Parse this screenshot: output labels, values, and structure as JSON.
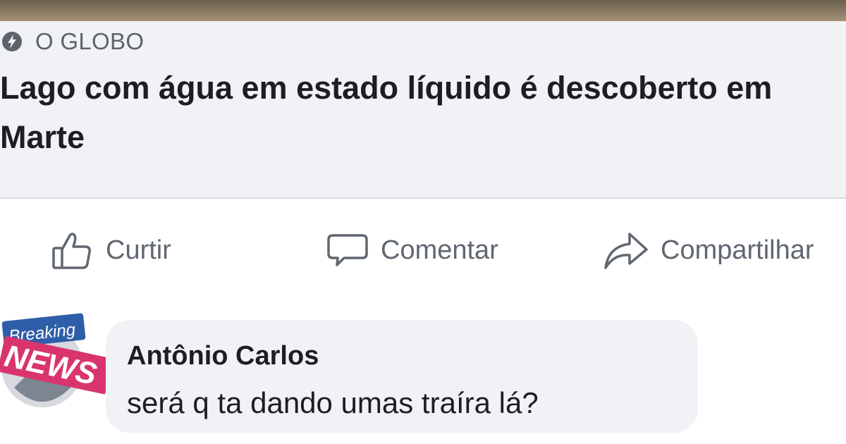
{
  "post": {
    "source": "O GLOBO",
    "source_icon": "bolt-circle-icon",
    "headline": "Lago com água em estado líquido é descoberto em Marte"
  },
  "actions": {
    "like": {
      "label": "Curtir",
      "icon": "thumbs-up-icon"
    },
    "comment": {
      "label": "Comentar",
      "icon": "speech-bubble-icon"
    },
    "share": {
      "label": "Compartilhar",
      "icon": "share-arrow-icon"
    }
  },
  "comment": {
    "avatar": {
      "line1": "Breaking",
      "line2": "NEWS"
    },
    "author": "Antônio Carlos",
    "text": "será q ta dando umas traíra lá?"
  },
  "colors": {
    "card_bg": "#f1f2f5",
    "text_primary": "#1c1e21",
    "text_secondary": "#606770",
    "badge_pink": "#d9346e",
    "badge_blue": "#2f5ea8"
  }
}
